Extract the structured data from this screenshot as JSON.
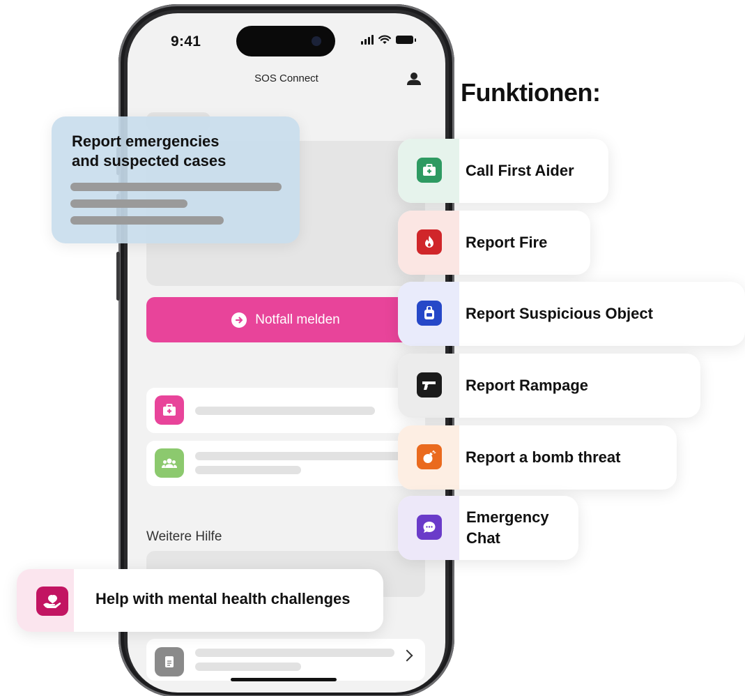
{
  "statusbar": {
    "time": "9:41"
  },
  "app": {
    "title": "SOS Connect"
  },
  "emergency_button": {
    "label": "Notfall melden"
  },
  "section": {
    "more_help": "Weitere Hilfe"
  },
  "heading": "Funktionen:",
  "callout": {
    "text": "Report emergencies\nand suspected cases"
  },
  "features": [
    {
      "label": "Call First Aider",
      "icon": "first-aid-kit-icon",
      "color": "#2e9a62"
    },
    {
      "label": "Report Fire",
      "icon": "fire-icon",
      "color": "#d0262a"
    },
    {
      "label": "Report Suspicious Object",
      "icon": "suspicious-bag-icon",
      "color": "#2648c8"
    },
    {
      "label": "Report Rampage",
      "icon": "gun-icon",
      "color": "#1b1b1b"
    },
    {
      "label": "Report a bomb threat",
      "icon": "bomb-icon",
      "color": "#ea6a1e"
    },
    {
      "label": "Emergency\nChat",
      "icon": "chat-bubble-icon",
      "color": "#6a3bc9"
    }
  ],
  "mental_health": {
    "label": "Help with mental health challenges",
    "icon": "helping-hand-icon",
    "color": "#c21562"
  },
  "colors": {
    "accent_pink": "#e8449a",
    "screen_bg": "#f2f2f2"
  }
}
